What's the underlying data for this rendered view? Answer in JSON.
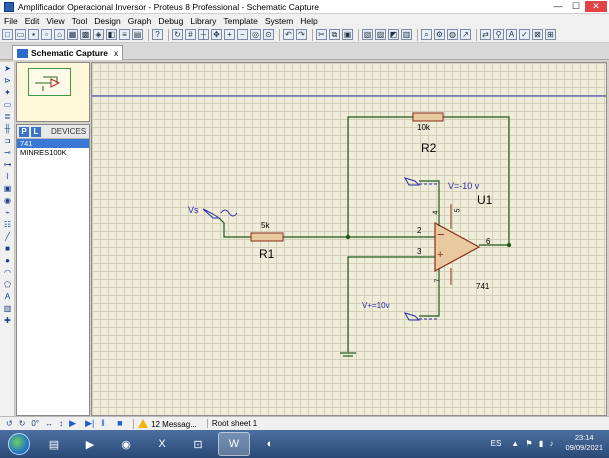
{
  "window": {
    "title": "Amplificador Operacional Inversor - Proteus 8 Professional - Schematic Capture",
    "min": "—",
    "max": "☐",
    "close": "✕"
  },
  "menu": [
    "File",
    "Edit",
    "View",
    "Tool",
    "Design",
    "Graph",
    "Debug",
    "Library",
    "Template",
    "System",
    "Help"
  ],
  "tab": {
    "label": "Schematic Capture",
    "close": "x"
  },
  "devices": {
    "p_label": "P",
    "l_label": "L",
    "header": "DEVICES",
    "items": [
      "741",
      "MINRES100K"
    ],
    "selected": "741"
  },
  "schematic": {
    "r1": {
      "name": "R1",
      "value": "5k"
    },
    "r2": {
      "name": "R2",
      "value": "10k"
    },
    "u1": {
      "name": "U1",
      "part": "741",
      "pin_inv": "2",
      "pin_noninv": "3",
      "pin_out": "6",
      "pin_v_minus": "4",
      "pin_v_plus": "7",
      "pin_offset": "5",
      "minus_sign": "−",
      "plus_sign": "+"
    },
    "source": {
      "label": "Vs"
    },
    "v_minus": {
      "label": "V=-10 v"
    },
    "v_plus": {
      "label": "V+=10v"
    }
  },
  "status": {
    "rotation": "0°",
    "messages": "12 Messag...",
    "sheet": "Root sheet 1"
  },
  "taskbar": {
    "lang": "ES",
    "time": "23:14",
    "date": "09/09/2021"
  }
}
